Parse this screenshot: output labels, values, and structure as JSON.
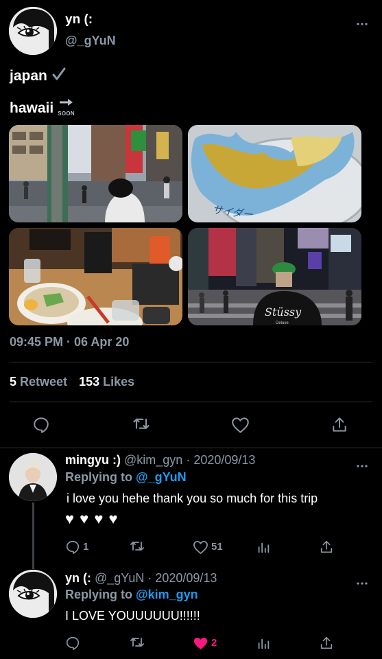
{
  "main_tweet": {
    "display_name": "yn (:",
    "handle": "@_gYuN",
    "line1": "japan",
    "line2": "hawaii",
    "soon_label": "SOON",
    "timestamp": "09:45 PM · 06 Apr 20",
    "retweets_count": "5",
    "retweets_label": "Retweet",
    "likes_count": "153",
    "likes_label": "Likes",
    "photo_text_can": "サイダー",
    "photo_text_shirt": "Stüssy",
    "photo_text_shirt_sub": "Deluxe"
  },
  "replies": [
    {
      "display_name": "mingyu :)",
      "handle": "@kim_gyn",
      "date": "· 2020/09/13",
      "replying_prefix": "Replying to",
      "replying_to": "@_gYuN",
      "text": "i love you hehe thank you so much for this trip",
      "hearts": "♥ ♥ ♥ ♥",
      "replies_count": "1",
      "likes_count": "51"
    },
    {
      "display_name": "yn (:",
      "handle": "@_gYuN",
      "date": "· 2020/09/13",
      "replying_prefix": "Replying to",
      "replying_to": "@kim_gyn",
      "text": "I LOVE YOUUUUUU!!!!!!",
      "likes_count": "2"
    }
  ],
  "colors": {
    "background": "#000000",
    "muted": "#8b98a5",
    "link": "#1d9bf0",
    "liked": "#f91880",
    "divider": "#2f3336"
  },
  "icons": [
    "more-icon",
    "checkmark-icon",
    "arrow-right-icon",
    "reply-icon",
    "retweet-icon",
    "like-icon",
    "share-icon",
    "analytics-icon"
  ]
}
